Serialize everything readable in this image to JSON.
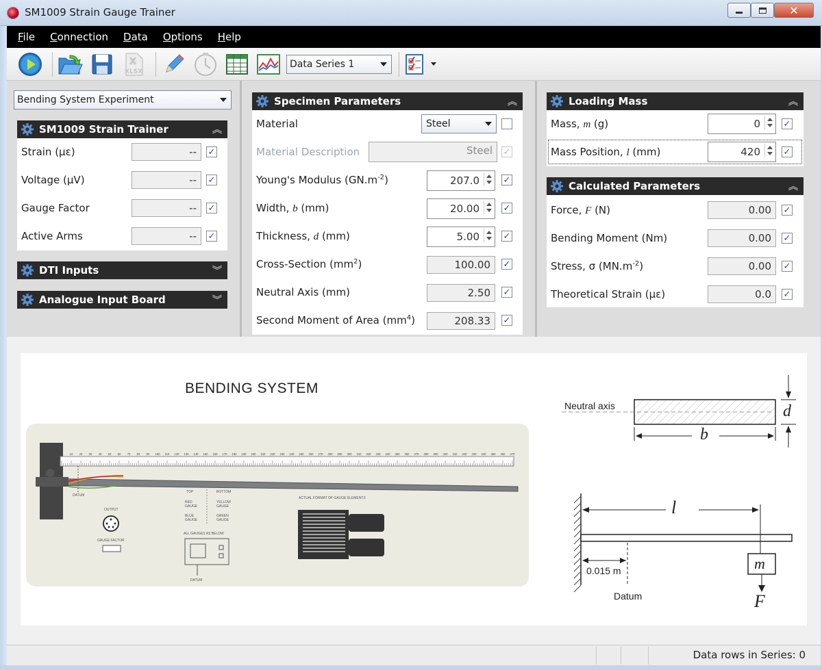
{
  "window": {
    "title": "SM1009 Strain Gauge Trainer",
    "min": "▭",
    "max": "▢",
    "close": "✕"
  },
  "menu": [
    "File",
    "Connection",
    "Data",
    "Options",
    "Help"
  ],
  "toolbar": {
    "icons": [
      "play-icon",
      "open-icon",
      "save-icon",
      "export-xlsx-icon",
      "pencil-icon",
      "clock-icon",
      "table-icon",
      "chart-icon",
      "checklist-icon"
    ],
    "series_select": "Data Series 1",
    "xlsx_label": "XLSX"
  },
  "experiment_select": "Bending System Experiment",
  "trainer": {
    "title": "SM1009 Strain Trainer",
    "rows": [
      {
        "label": "Strain  (µε)",
        "value": "--",
        "checked": true
      },
      {
        "label": "Voltage  (µV)",
        "value": "--",
        "checked": true
      },
      {
        "label": "Gauge Factor",
        "value": "--",
        "checked": true
      },
      {
        "label": "Active Arms",
        "value": "--",
        "checked": true
      }
    ]
  },
  "dti": {
    "title": "DTI Inputs"
  },
  "analogue": {
    "title": "Analogue Input Board"
  },
  "specimen": {
    "title": "Specimen Parameters",
    "material_label": "Material",
    "material_value": "Steel",
    "desc_label": "Material Description",
    "desc_value": "Steel",
    "rows": [
      {
        "label": "Young's Modulus  (GN.m",
        "sup": "-2",
        "tail": ")",
        "value": "207.0",
        "edit": true
      },
      {
        "label": "Width, ",
        "var": "b",
        "tail": "  (mm)",
        "value": "20.00",
        "edit": true
      },
      {
        "label": "Thickness, ",
        "var": "d",
        "tail": "  (mm)",
        "value": "5.00",
        "edit": true
      },
      {
        "label": "Cross-Section  (mm",
        "sup": "2",
        "tail": ")",
        "value": "100.00",
        "edit": false
      },
      {
        "label": "Neutral Axis  (mm)",
        "value": "2.50",
        "edit": false
      },
      {
        "label": "Second Moment of Area  (mm",
        "sup": "4",
        "tail": ")",
        "value": "208.33",
        "edit": false
      }
    ]
  },
  "loading": {
    "title": "Loading Mass",
    "mass_label": "Mass, ",
    "mass_var": "m",
    "mass_unit": "  (g)",
    "mass_value": "0",
    "pos_label": "Mass Position, ",
    "pos_var": "l",
    "pos_unit": "  (mm)",
    "pos_value": "420"
  },
  "calculated": {
    "title": "Calculated Parameters",
    "rows": [
      {
        "label": "Force, ",
        "var": "F",
        "tail": "  (N)",
        "value": "0.00"
      },
      {
        "label": "Bending Moment  (Nm)",
        "value": "0.00"
      },
      {
        "label": "Stress, σ  (MN.m",
        "sup": "-2",
        "tail": ")",
        "value": "0.00"
      },
      {
        "label": "Theoretical Strain  (µε)",
        "value": "0.0"
      }
    ]
  },
  "diagram": {
    "title": "BENDING SYSTEM",
    "neutral_axis": "Neutral axis",
    "d": "d",
    "b": "b",
    "l": "l",
    "m": "m",
    "F": "F",
    "offset": "0.015 m",
    "datum": "Datum",
    "rig_labels": {
      "datum": "DATUM",
      "output": "OUTPUT",
      "gauge_factor": "GAUGE FACTOR",
      "top": "TOP",
      "bottom": "BOTTOM",
      "red": "RED\nGAUGE",
      "yellow": "YELLOW\nGAUGE",
      "blue": "BLUE\nGAUGE",
      "green": "GREEN\nGAUGE",
      "all": "ALL GAUGES AS BELOW",
      "actual": "ACTUAL FORMAT OF GAUGE ELEMENTS"
    },
    "scale_ticks": [
      "10",
      "20",
      "30",
      "40",
      "50",
      "60",
      "70",
      "80",
      "90",
      "100",
      "110",
      "120",
      "130",
      "140",
      "150",
      "160",
      "170",
      "180",
      "190",
      "200",
      "210",
      "220",
      "230",
      "240",
      "250",
      "260",
      "270",
      "280",
      "290",
      "300",
      "310",
      "320",
      "330",
      "340",
      "350",
      "360",
      "370",
      "380",
      "390",
      "400",
      "410",
      "420",
      "430",
      "440",
      "450",
      "460",
      "470"
    ]
  },
  "status": {
    "rows": "Data rows in Series: 0"
  }
}
